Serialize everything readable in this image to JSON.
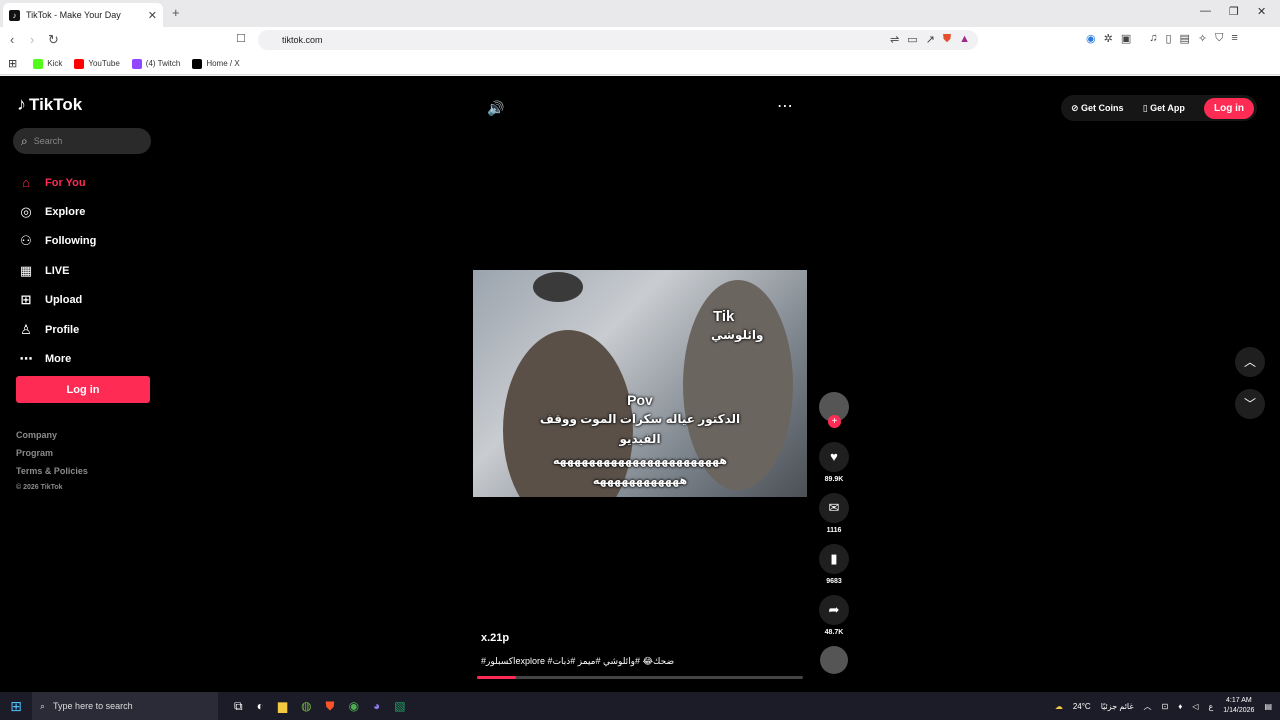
{
  "browser": {
    "tab_title": "TikTok - Make Your Day",
    "url": "tiktok.com",
    "bookmarks": [
      "Kick",
      "YouTube",
      "(4) Twitch",
      "Home / X"
    ]
  },
  "sidebar": {
    "brand": "TikTok",
    "search_placeholder": "Search",
    "items": [
      {
        "label": "For You",
        "icon": "home-icon"
      },
      {
        "label": "Explore",
        "icon": "compass-icon"
      },
      {
        "label": "Following",
        "icon": "user-plus-icon"
      },
      {
        "label": "LIVE",
        "icon": "live-icon"
      },
      {
        "label": "Upload",
        "icon": "plus-square-icon"
      },
      {
        "label": "Profile",
        "icon": "user-icon"
      },
      {
        "label": "More",
        "icon": "more-icon"
      }
    ],
    "login_label": "Log in",
    "footer": [
      "Company",
      "Program",
      "Terms & Policies",
      "© 2026 TikTok"
    ]
  },
  "header": {
    "get_coins": "Get Coins",
    "get_app": "Get App",
    "login": "Log in"
  },
  "video": {
    "overlay_top_title": "Tik",
    "overlay_top_sub": "وائلوشي",
    "overlay_pov": "Pov",
    "overlay_line1": "الدكتور عياله سكرات الموت ووقف",
    "overlay_line2": "الفيديو",
    "overlay_line3": "هههههههههههههههههههههههه",
    "overlay_line4": "ههههههههههههه",
    "author": "x.21p",
    "caption": "#اكسبلورexplore #ضحك😂 #وائلوشي #ميمز #ذبات",
    "progress_percent": 12
  },
  "actions": {
    "likes": "89.9K",
    "comments": "1116",
    "saves": "9683",
    "shares": "48.7K"
  },
  "taskbar": {
    "search_placeholder": "Type here to search",
    "weather": "24°C",
    "weather_text": "غائم جزئيًا",
    "lang": "ع",
    "time": "4:17 AM",
    "date": "1/14/2026"
  },
  "colors": {
    "accent": "#fe2c55"
  }
}
